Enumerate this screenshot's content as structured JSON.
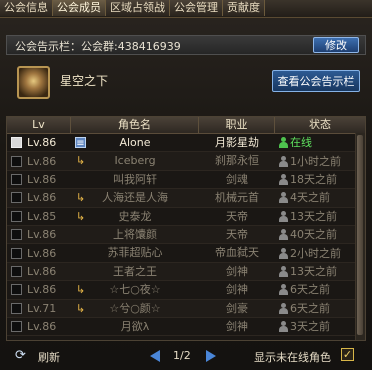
{
  "tabs": [
    "公会信息",
    "公会成员",
    "区域占领战",
    "公会管理",
    "贡献度"
  ],
  "announcement": {
    "text": "公会告示栏：公会群:438416939",
    "edit_label": "修改"
  },
  "guild": {
    "name": "星空之下",
    "view_board_label": "查看公会告示栏"
  },
  "table": {
    "headers": [
      "Lv",
      "角色名",
      "职业",
      "状态"
    ],
    "rows": [
      {
        "lv": "Lv.86",
        "name": "Alone",
        "job": "月影星劫",
        "state": "在线",
        "online": true,
        "rank": "leader",
        "checked": true
      },
      {
        "lv": "Lv.86",
        "name": "Iceberg",
        "job": "刹那永恒",
        "state": "1小时之前",
        "online": false,
        "rank": "officer",
        "checked": false
      },
      {
        "lv": "Lv.86",
        "name": "叫我阿轩",
        "job": "剑魂",
        "state": "18天之前",
        "online": false,
        "rank": "none",
        "checked": false
      },
      {
        "lv": "Lv.86",
        "name": "人海还是人海",
        "job": "机械元首",
        "state": "4天之前",
        "online": false,
        "rank": "officer",
        "checked": false
      },
      {
        "lv": "Lv.85",
        "name": "史泰龙",
        "job": "天帝",
        "state": "13天之前",
        "online": false,
        "rank": "officer",
        "checked": false
      },
      {
        "lv": "Lv.86",
        "name": "上将馕颜",
        "job": "天帝",
        "state": "40天之前",
        "online": false,
        "rank": "none",
        "checked": false
      },
      {
        "lv": "Lv.86",
        "name": "苏菲超贴心",
        "job": "帝血弑天",
        "state": "2小时之前",
        "online": false,
        "rank": "none",
        "checked": false
      },
      {
        "lv": "Lv.86",
        "name": "王者之王",
        "job": "剑神",
        "state": "13天之前",
        "online": false,
        "rank": "none",
        "checked": false
      },
      {
        "lv": "Lv.86",
        "name": "☆七○夜☆",
        "job": "剑神",
        "state": "6天之前",
        "online": false,
        "rank": "officer",
        "checked": false
      },
      {
        "lv": "Lv.71",
        "name": "☆兮○颜☆",
        "job": "剑豪",
        "state": "6天之前",
        "online": false,
        "rank": "officer",
        "checked": false
      },
      {
        "lv": "Lv.86",
        "name": "月欲λ",
        "job": "剑神",
        "state": "3天之前",
        "online": false,
        "rank": "none",
        "checked": false
      }
    ]
  },
  "footer": {
    "refresh_label": "刷新",
    "page": "1/2",
    "show_offline_label": "显示未在线角色",
    "show_offline_checked": true
  }
}
